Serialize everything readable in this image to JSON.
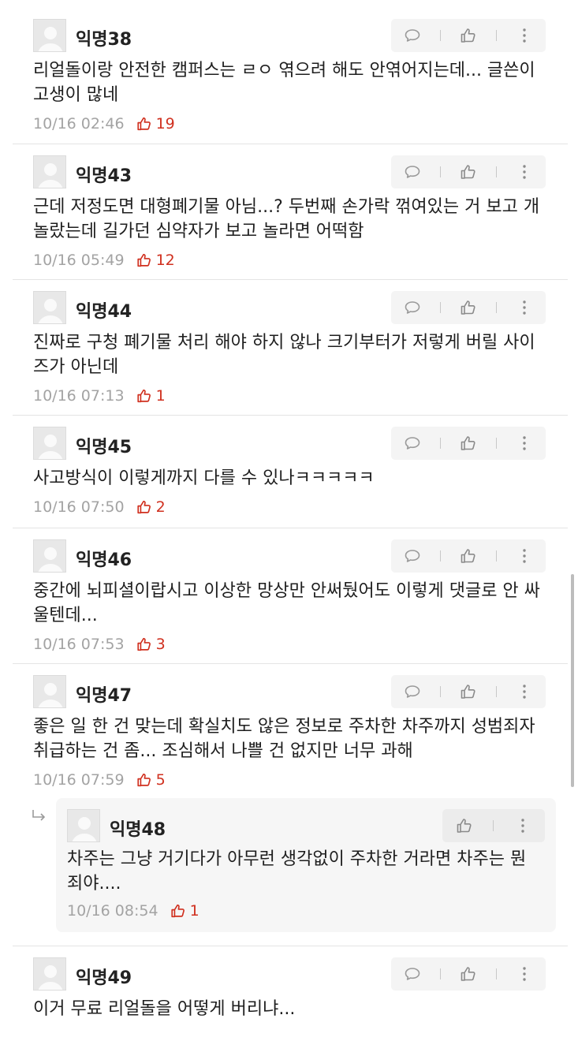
{
  "comments": [
    {
      "author": "익명38",
      "text": "리얼돌이랑 안전한 캠퍼스는 ㄹㅇ 엮으려 해도 안엮어지는데... 글쓴이 고생이 많네",
      "date": "10/16 02:46",
      "likes": "19"
    },
    {
      "author": "익명43",
      "text": "근데 저정도면 대형폐기물 아님...? 두번째 손가락 꺾여있는 거 보고 개놀랐는데 길가던 심약자가 보고 놀라면 어떡함",
      "date": "10/16 05:49",
      "likes": "12"
    },
    {
      "author": "익명44",
      "text": "진짜로 구청 폐기물 처리 해야 하지 않나 크기부터가 저렇게 버릴 사이즈가 아닌데",
      "date": "10/16 07:13",
      "likes": "1"
    },
    {
      "author": "익명45",
      "text": "사고방식이 이렇게까지 다를 수 있나ㅋㅋㅋㅋㅋ",
      "date": "10/16 07:50",
      "likes": "2"
    },
    {
      "author": "익명46",
      "text": "중간에 뇌피셜이랍시고 이상한 망상만 안써뒀어도 이렇게 댓글로 안 싸울텐데...",
      "date": "10/16 07:53",
      "likes": "3"
    },
    {
      "author": "익명47",
      "text": "좋은 일 한 건 맞는데 확실치도 않은 정보로 주차한 차주까지 성범죄자 취급하는 건 좀... 조심해서 나쁠 건 없지만 너무 과해",
      "date": "10/16 07:59",
      "likes": "5"
    }
  ],
  "reply": {
    "author": "익명48",
    "text": "차주는 그냥 거기다가 아무런 생각없이 주차한 거라면 차주는 뭔 죄야....",
    "date": "10/16 08:54",
    "likes": "1"
  },
  "last": {
    "author": "익명49",
    "text": "이거 무료 리얼돌을 어떻게 버리냐..."
  },
  "colors": {
    "like_red": "#d0301f",
    "date_gray": "#a3a3a3",
    "action_bg": "#f4f4f4"
  },
  "icons": [
    "comment-icon",
    "thumbs-up-icon",
    "more-vertical-icon",
    "reply-arrow-icon",
    "avatar-icon"
  ]
}
